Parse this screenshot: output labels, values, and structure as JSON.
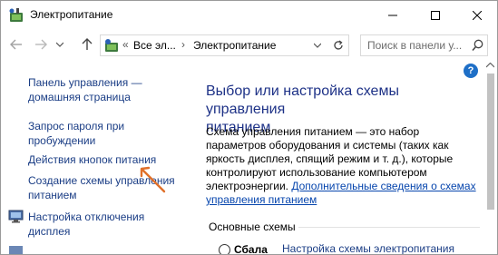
{
  "window": {
    "title": "Электропитание",
    "controls": {
      "minimize": "minimize",
      "maximize": "maximize",
      "close": "close"
    }
  },
  "navbar": {
    "overflow_chevron": "«",
    "breadcrumb": [
      "Все эл...",
      "Электропитание"
    ],
    "search_placeholder": "Поиск в панели у..."
  },
  "help_label": "?",
  "sidebar": {
    "home_link": [
      "Панель управления —",
      "домашняя страница"
    ],
    "items": [
      {
        "lines": [
          "Запрос пароля при",
          "пробуждении"
        ]
      },
      {
        "lines": [
          "Действия кнопок питания"
        ]
      },
      {
        "lines": [
          "Создание схемы управления",
          "питанием"
        ]
      },
      {
        "lines": [
          "Настройка отключения",
          "дисплея"
        ],
        "icon": "monitor-icon"
      }
    ]
  },
  "main": {
    "title": [
      "Выбор или настройка схемы управления",
      "питанием"
    ],
    "description": "Схема управления питанием — это набор параметров оборудования и системы (таких как яркость дисплея, спящий режим и т. д.), которые контролируют использование компьютером электроэнергии. ",
    "more_link": "Дополнительные сведения о схемах управления питанием",
    "section_title": "Основные схемы",
    "plans": [
      {
        "name": "Сбала",
        "settings_link": "Настройка схемы электропитания",
        "selected": false
      }
    ]
  },
  "colors": {
    "link": "#1a3d85",
    "title": "#1e3287",
    "help": "#1e6fc7",
    "annotation_arrow": "#e0702a"
  }
}
